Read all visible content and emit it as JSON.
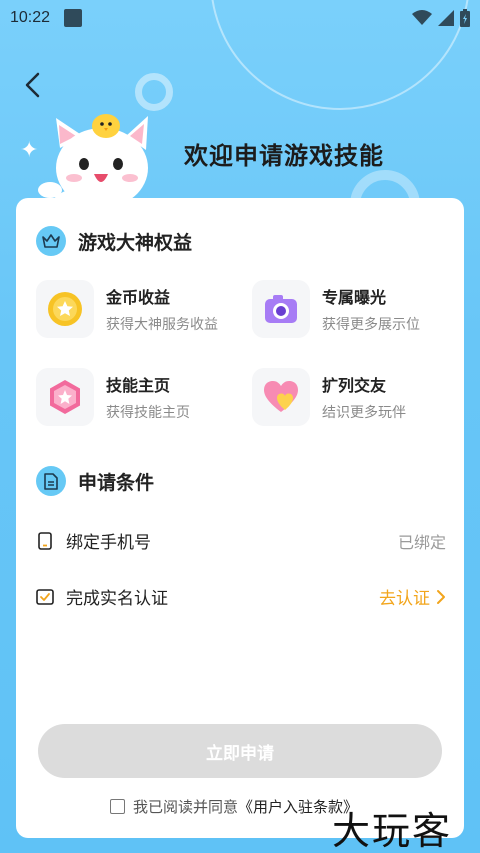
{
  "status_bar": {
    "time": "10:22"
  },
  "header": {
    "title": "欢迎申请游戏技能"
  },
  "benefits_section": {
    "title": "游戏大神权益",
    "items": [
      {
        "title": "金币收益",
        "desc": "获得大神服务收益",
        "icon": "coin-icon",
        "color": "#f7c325"
      },
      {
        "title": "专属曝光",
        "desc": "获得更多展示位",
        "icon": "camera-icon",
        "color": "#a77cf5"
      },
      {
        "title": "技能主页",
        "desc": "获得技能主页",
        "icon": "hexagon-star-icon",
        "color": "#f26a9c"
      },
      {
        "title": "扩列交友",
        "desc": "结识更多玩伴",
        "icon": "heart-icon",
        "color": "#f78bb3"
      }
    ]
  },
  "conditions_section": {
    "title": "申请条件",
    "items": [
      {
        "label": "绑定手机号",
        "value": "已绑定"
      },
      {
        "label": "完成实名认证",
        "action": "去认证"
      }
    ]
  },
  "apply_button": {
    "label": "立即申请"
  },
  "agreement": {
    "prefix": "我已阅读并同意",
    "link": "《用户入驻条款》",
    "checked": false
  },
  "watermark": {
    "text": "大玩客"
  },
  "colors": {
    "background": "#6cc8f8",
    "accent_orange": "#f2a51c",
    "section_icon": "#66c9f5",
    "button_disabled": "#dcdcdc"
  }
}
